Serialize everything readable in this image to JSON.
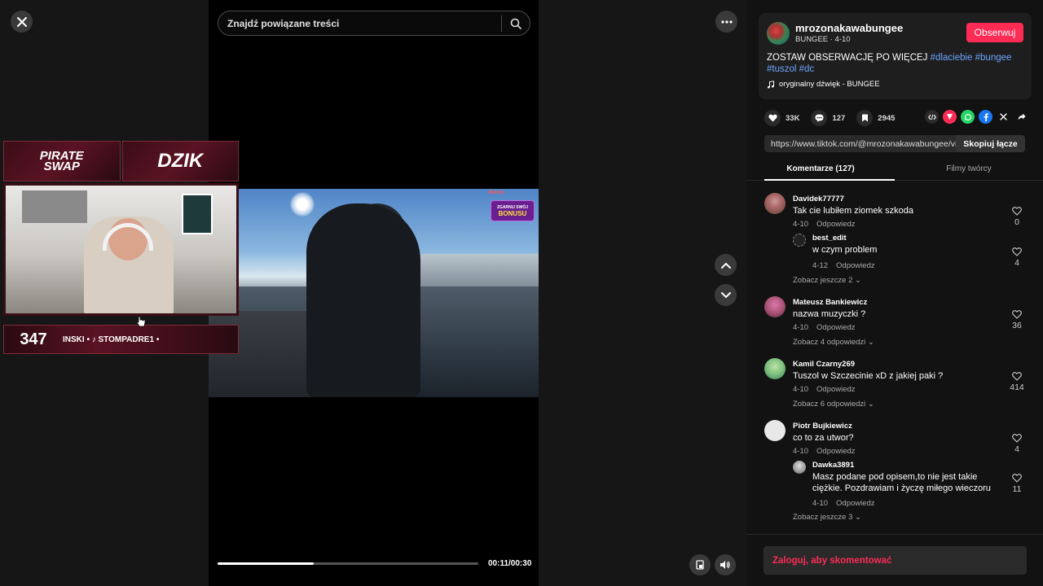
{
  "search": {
    "placeholder": "Znajdź powiązane treści"
  },
  "overlay": {
    "sponsor_left": "PIRATE SWAP",
    "sponsor_right": "DZIK",
    "counter": "347",
    "ticker": "INSKI • ♪ STOMPADRE1 •"
  },
  "video_promo": {
    "top": "Betclic",
    "line1": "ZGARNIJ SWÓJ",
    "line2": "BONUSU"
  },
  "player": {
    "time": "00:11/00:30",
    "progress": 0.37
  },
  "author": {
    "username": "mrozonakawabungee",
    "meta": "BUNGEE · 4-10",
    "follow_label": "Obserwuj"
  },
  "caption": {
    "text": "ZOSTAW OBSERWACJĘ PO WIĘCEJ ",
    "hashtags": [
      "#dlaciebie",
      "#bungee",
      "#tuszol",
      "#dc"
    ]
  },
  "sound": "oryginalny dźwięk - BUNGEE",
  "stats": {
    "likes": "33K",
    "comments": "127",
    "saves": "2945"
  },
  "share_icons": [
    "embed-icon",
    "share-tiktok-icon",
    "whatsapp-icon",
    "facebook-icon",
    "x-icon",
    "share-arrow-icon"
  ],
  "link": {
    "url": "https://www.tiktok.com/@mrozonakawabungee/vi...",
    "copy_label": "Skopiuj łącze"
  },
  "tabs": {
    "comments": "Komentarze (127)",
    "creator": "Filmy twórcy"
  },
  "comments": [
    {
      "user": "Davidek77777",
      "text": "Tak cie lubiłem ziomek szkoda",
      "date": "4-10",
      "reply": "Odpowiedz",
      "likes": "0",
      "replies": [
        {
          "user": "best_edit",
          "text": "w czym problem",
          "date": "4-12",
          "reply": "Odpowiedz",
          "likes": "4"
        }
      ],
      "more": "Zobacz jeszcze 2"
    },
    {
      "user": "Mateusz Bankiewicz",
      "text": "nazwa muzyczki ?",
      "date": "4-10",
      "reply": "Odpowiedz",
      "likes": "36",
      "more": "Zobacz 4 odpowiedzi"
    },
    {
      "user": "Kamil Czarny269",
      "text": "Tuszol w Szczecinie xD z jakiej paki ?",
      "date": "4-10",
      "reply": "Odpowiedz",
      "likes": "414",
      "more": "Zobacz 6 odpowiedzi"
    },
    {
      "user": "Piotr Bujkiewicz",
      "text": "co to za utwor?",
      "date": "4-10",
      "reply": "Odpowiedz",
      "likes": "4",
      "replies": [
        {
          "user": "Dawka3891",
          "text": "Masz podane pod opisem,to nie jest takie ciężkie. Pozdrawiam i życzę miłego wieczoru",
          "date": "4-10",
          "reply": "Odpowiedz",
          "likes": "11"
        }
      ],
      "more": "Zobacz jeszcze 3"
    }
  ],
  "login_prompt": "Zaloguj, aby skomentować",
  "colors": {
    "accent": "#fe2c55",
    "hashtag": "#6ea5ff",
    "panel_bg": "#121212"
  }
}
